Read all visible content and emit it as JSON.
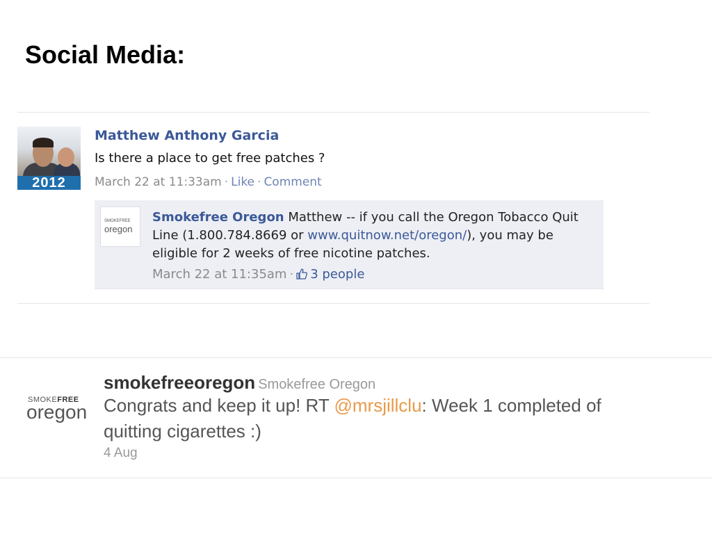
{
  "slide": {
    "title": "Social Media:"
  },
  "facebook": {
    "post": {
      "avatar_year": "2012",
      "author": "Matthew Anthony Garcia",
      "text": "Is there a place to get free patches ?",
      "timestamp": "March 22 at 11:33am",
      "like_label": "Like",
      "comment_label": "Comment"
    },
    "reply": {
      "avatar_small": "SMOKEFREE",
      "avatar_big": "oregon",
      "author": "Smokefree Oregon",
      "text_before": "Matthew -- if you call the Oregon Tobacco Quit Line (1.800.784.8669 or",
      "url": "www.quitnow.net/oregon/",
      "text_after": "), you may be eligible for 2 weeks of free nicotine patches.",
      "timestamp": "March 22 at 11:35am",
      "likes": "3 people"
    }
  },
  "twitter": {
    "logo_small_a": "SMOKE",
    "logo_small_b": "FREE",
    "logo_big": "oregon",
    "handle": "smokefreeoregon",
    "name": "Smokefree Oregon",
    "text_before": "Congrats and keep it up! RT",
    "mention": "@mrsjillclu",
    "text_after": ": Week 1 completed of quitting cigarettes :)",
    "date": "4 Aug"
  },
  "colors": {
    "facebook_blue": "#3b5998",
    "facebook_link": "#6d84b4",
    "reply_bg": "#edeff4",
    "twitter_mention": "#e89a4a"
  }
}
